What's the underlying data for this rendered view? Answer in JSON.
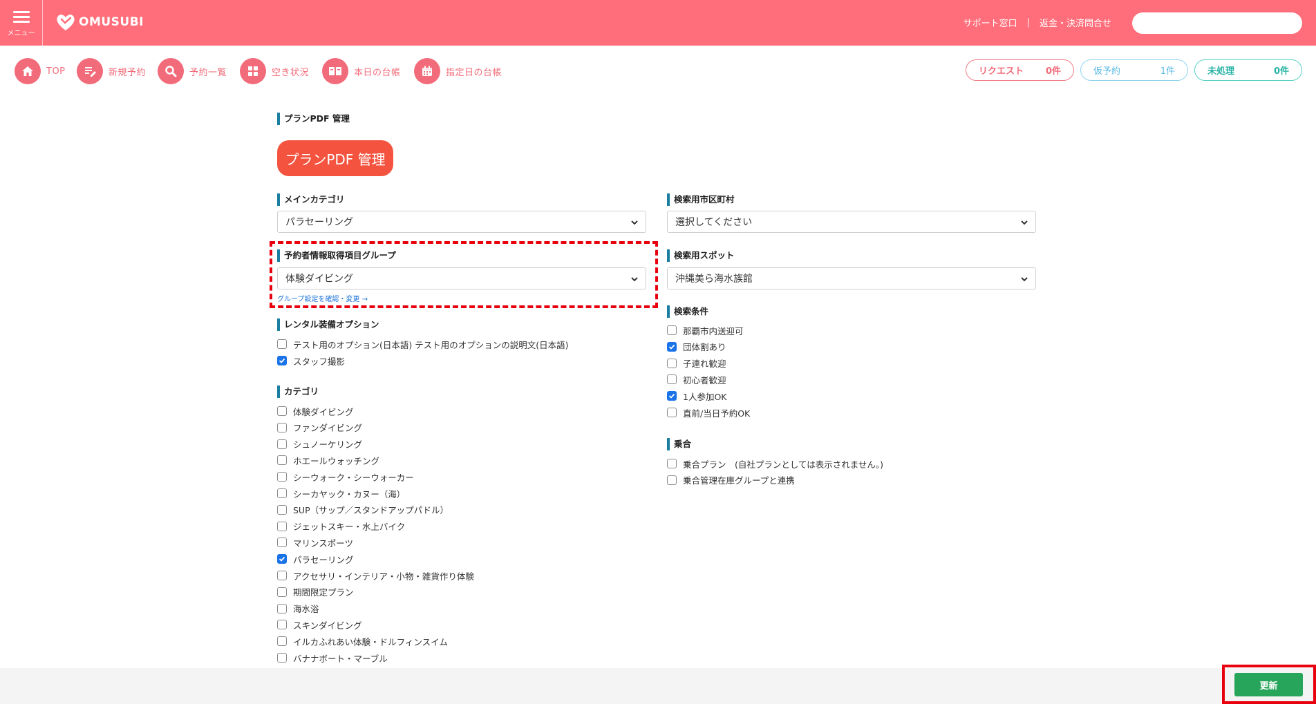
{
  "header": {
    "menu_label": "メニュー",
    "logo_text": "OMUSUBI",
    "support_link": "サポート窓口",
    "separator": "|",
    "refund_link": "返金・決済問合せ",
    "search_value": ""
  },
  "nav": {
    "items": [
      {
        "label": "TOP",
        "icon": "home-icon"
      },
      {
        "label": "新規予約",
        "icon": "edit-icon"
      },
      {
        "label": "予約一覧",
        "icon": "search-icon"
      },
      {
        "label": "空き状況",
        "icon": "grid-icon"
      },
      {
        "label": "本日の台帳",
        "icon": "book-icon"
      },
      {
        "label": "指定日の台帳",
        "icon": "calendar-icon"
      }
    ],
    "pills": [
      {
        "label": "リクエスト",
        "count": "0件"
      },
      {
        "label": "仮予約",
        "count": "1件"
      },
      {
        "label": "未処理",
        "count": "0件"
      }
    ]
  },
  "page": {
    "section_title": "プランPDF 管理",
    "pdf_button": "プランPDF 管理"
  },
  "form": {
    "main_category": {
      "label": "メインカテゴリ",
      "value": "パラセーリング"
    },
    "search_city": {
      "label": "検索用市区町村",
      "value": "選択してください"
    },
    "booker_group": {
      "label": "予約者情報取得項目グループ",
      "value": "体験ダイビング",
      "link": "グループ設定を確認・変更 →"
    },
    "search_spot": {
      "label": "検索用スポット",
      "value": "沖縄美ら海水族館"
    },
    "rental": {
      "label": "レンタル装備オプション",
      "items": [
        {
          "label": "テスト用のオプション(日本語) テスト用のオプションの説明文(日本語)",
          "checked": false
        },
        {
          "label": "スタッフ撮影",
          "checked": true
        }
      ]
    },
    "search_conditions": {
      "label": "検索条件",
      "items": [
        {
          "label": "那覇市内送迎可",
          "checked": false
        },
        {
          "label": "団体割あり",
          "checked": true
        },
        {
          "label": "子連れ歓迎",
          "checked": false
        },
        {
          "label": "初心者歓迎",
          "checked": false
        },
        {
          "label": "1人参加OK",
          "checked": true
        },
        {
          "label": "直前/当日予約OK",
          "checked": false
        }
      ]
    },
    "shared": {
      "label": "乗合",
      "items": [
        {
          "label": "乗合プラン　(自社プランとしては表示されません。)",
          "checked": false
        },
        {
          "label": "乗合管理在庫グループと連携",
          "checked": false
        }
      ]
    },
    "category": {
      "label": "カテゴリ",
      "items": [
        {
          "label": "体験ダイビング",
          "checked": false
        },
        {
          "label": "ファンダイビング",
          "checked": false
        },
        {
          "label": "シュノーケリング",
          "checked": false
        },
        {
          "label": "ホエールウォッチング",
          "checked": false
        },
        {
          "label": "シーウォーク・シーウォーカー",
          "checked": false
        },
        {
          "label": "シーカヤック・カヌー（海）",
          "checked": false
        },
        {
          "label": "SUP（サップ／スタンドアップパドル）",
          "checked": false
        },
        {
          "label": "ジェットスキー・水上バイク",
          "checked": false
        },
        {
          "label": "マリンスポーツ",
          "checked": false
        },
        {
          "label": "パラセーリング",
          "checked": true
        },
        {
          "label": "アクセサリ・インテリア・小物・雑貨作り体験",
          "checked": false
        },
        {
          "label": "期間限定プラン",
          "checked": false
        },
        {
          "label": "海水浴",
          "checked": false
        },
        {
          "label": "スキンダイビング",
          "checked": false
        },
        {
          "label": "イルカふれあい体験・ドルフィンスイム",
          "checked": false
        },
        {
          "label": "バナナボート・マーブル",
          "checked": false
        }
      ]
    }
  },
  "footer": {
    "update_button": "更新"
  },
  "colors": {
    "header": "#ff6e7a",
    "nav_accent": "#f26b7a",
    "pdf_button": "#f4543f",
    "update_button": "#27a55a",
    "highlight": "#e8000e",
    "checkbox_checked": "#1a73e8"
  }
}
